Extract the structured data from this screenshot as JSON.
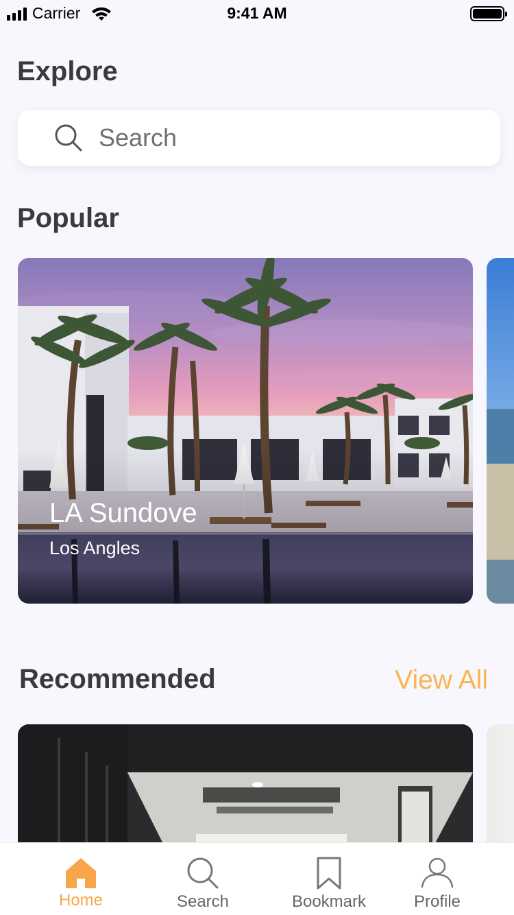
{
  "status_bar": {
    "carrier": "Carrier",
    "time": "9:41 AM"
  },
  "explore": {
    "title": "Explore"
  },
  "search": {
    "placeholder": "Search"
  },
  "popular": {
    "title": "Popular",
    "cards": [
      {
        "name": "LA Sundove",
        "location": "Los Angles"
      }
    ]
  },
  "recommended": {
    "title": "Recommended",
    "view_all_label": "View All"
  },
  "tab_bar": {
    "tabs": [
      {
        "label": "Home",
        "icon": "home-icon",
        "active": true
      },
      {
        "label": "Search",
        "icon": "search-icon",
        "active": false
      },
      {
        "label": "Bookmark",
        "icon": "bookmark-icon",
        "active": false
      },
      {
        "label": "Profile",
        "icon": "profile-icon",
        "active": false
      }
    ]
  },
  "colors": {
    "accent": "#f9a64b",
    "background": "#f8f7fd",
    "text": "#3a3a3a"
  }
}
